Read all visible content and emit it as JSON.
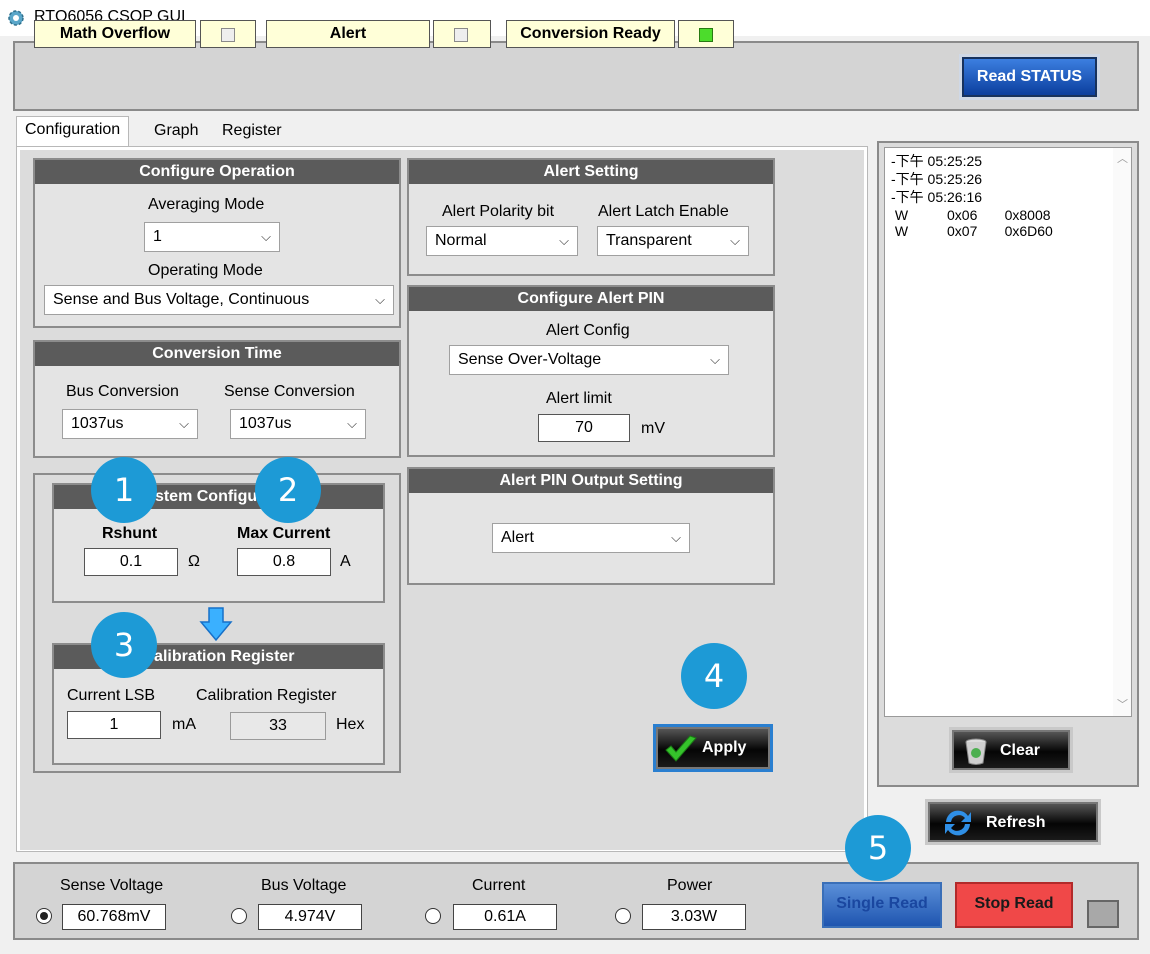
{
  "window": {
    "title": "RTQ6056 CSOP GUI"
  },
  "flags": [
    {
      "label": "Math Overflow",
      "checked": false
    },
    {
      "label": "Alert",
      "checked": false
    },
    {
      "label": "Conversion Ready",
      "checked": true
    }
  ],
  "read_status_label": "Read STATUS",
  "tabs": [
    "Configuration",
    "Graph",
    "Register"
  ],
  "configure_operation": {
    "title": "Configure Operation",
    "averaging_label": "Averaging Mode",
    "averaging_value": "1",
    "operating_label": "Operating Mode",
    "operating_value": "Sense and Bus Voltage, Continuous"
  },
  "conversion_time": {
    "title": "Conversion Time",
    "bus_label": "Bus Conversion",
    "bus_value": "1037us",
    "sense_label": "Sense Conversion",
    "sense_value": "1037us"
  },
  "system_config": {
    "title": "System Configuration",
    "rshunt_label": "Rshunt",
    "rshunt_value": "0.1",
    "rshunt_unit": "Ω",
    "maxcur_label": "Max Current",
    "maxcur_value": "0.8",
    "maxcur_unit": "A"
  },
  "calibration": {
    "title": "Calibration Register",
    "lsb_label": "Current LSB",
    "lsb_value": "1",
    "lsb_unit": "mA",
    "reg_label": "Calibration Register",
    "reg_value": "33",
    "reg_unit": "Hex"
  },
  "alert_setting": {
    "title": "Alert Setting",
    "polarity_label": "Alert Polarity bit",
    "polarity_value": "Normal",
    "latch_label": "Alert Latch Enable",
    "latch_value": "Transparent"
  },
  "alert_pin": {
    "title": "Configure Alert PIN",
    "config_label": "Alert Config",
    "config_value": "Sense Over-Voltage",
    "limit_label": "Alert limit",
    "limit_value": "70",
    "limit_unit": "mV"
  },
  "alert_output": {
    "title": "Alert PIN Output Setting",
    "value": "Alert"
  },
  "apply_label": "Apply",
  "log": [
    "-下午 05:25:25",
    "-下午 05:25:26",
    "-下午 05:26:16",
    " W          0x06       0x8008",
    " W          0x07       0x6D60"
  ],
  "clear_label": "Clear",
  "refresh_label": "Refresh",
  "measurements": [
    {
      "label": "Sense Voltage",
      "value": "60.768mV",
      "selected": true
    },
    {
      "label": "Bus Voltage",
      "value": "4.974V",
      "selected": false
    },
    {
      "label": "Current",
      "value": "0.61A",
      "selected": false
    },
    {
      "label": "Power",
      "value": "3.03W",
      "selected": false
    }
  ],
  "single_read_label": "Single Read",
  "stop_read_label": "Stop Read",
  "badges": [
    "1",
    "2",
    "3",
    "4",
    "5"
  ],
  "colors": {
    "accent": "#1d9ad6",
    "conversion_ready": "#4cdc2c",
    "stop_read": "#f04848"
  }
}
